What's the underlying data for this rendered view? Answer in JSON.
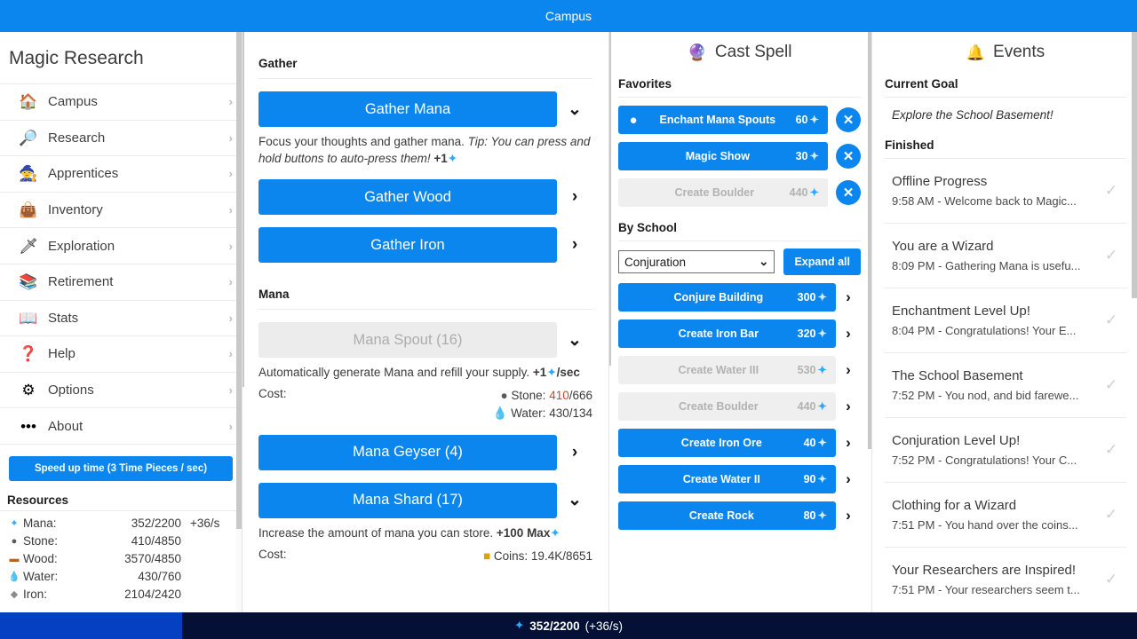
{
  "window": {
    "title": "Campus"
  },
  "sidebar": {
    "app_title": "Magic Research",
    "items": [
      {
        "label": "Campus",
        "icon": "house-icon",
        "glyph": "🏠",
        "chevron": "›"
      },
      {
        "label": "Research",
        "icon": "magnifier-icon",
        "glyph": "🔎",
        "chevron": "›"
      },
      {
        "label": "Apprentices",
        "icon": "wizard-hat-icon",
        "glyph": "🧙",
        "chevron": "›"
      },
      {
        "label": "Inventory",
        "icon": "sack-icon",
        "glyph": "👜",
        "chevron": "›"
      },
      {
        "label": "Exploration",
        "icon": "sword-icon",
        "glyph": "🗡",
        "chevron": "›"
      },
      {
        "label": "Retirement",
        "icon": "books-icon",
        "glyph": "📚",
        "chevron": "›"
      },
      {
        "label": "Stats",
        "icon": "open-book-icon",
        "glyph": "📖",
        "chevron": "›"
      },
      {
        "label": "Help",
        "icon": "question-key-icon",
        "glyph": "❓",
        "chevron": "›"
      },
      {
        "label": "Options",
        "icon": "gear-icon",
        "glyph": "⚙",
        "chevron": "›"
      },
      {
        "label": "About",
        "icon": "ellipsis-icon",
        "glyph": "•••",
        "chevron": "›"
      }
    ],
    "speed_up_label": "Speed up time (3 Time Pieces / sec)",
    "resources_title": "Resources",
    "resources": [
      {
        "icon": "mana-star-icon",
        "glyph": "⭐",
        "name": "Mana:",
        "value": "352/2200",
        "rate": "+36/s"
      },
      {
        "icon": "stone-icon",
        "glyph": "●",
        "name": "Stone:",
        "value": "410/4850",
        "rate": ""
      },
      {
        "icon": "wood-icon",
        "glyph": "▬",
        "name": "Wood:",
        "value": "3570/4850",
        "rate": ""
      },
      {
        "icon": "water-drop-icon",
        "glyph": "💧",
        "name": "Water:",
        "value": "430/760",
        "rate": ""
      },
      {
        "icon": "iron-icon",
        "glyph": "◆",
        "name": "Iron:",
        "value": "2104/2420",
        "rate": ""
      }
    ]
  },
  "gather": {
    "section_title": "Gather",
    "buttons": [
      {
        "label": "Gather Mana",
        "disabled": false,
        "chevron": "⌄",
        "expanded": true
      },
      {
        "label": "Gather Wood",
        "disabled": false,
        "chevron": "›",
        "expanded": false
      },
      {
        "label": "Gather Iron",
        "disabled": false,
        "chevron": "›",
        "expanded": false
      }
    ],
    "mana_desc_plain": "Focus your thoughts and gather mana. ",
    "mana_desc_italic": "Tip: You can press and hold buttons to auto-press them!",
    "mana_desc_gain": " +1",
    "mana_section_title": "Mana"
  },
  "mana": {
    "spout": {
      "label": "Mana Spout (16)",
      "disabled": true,
      "chevron": "⌄",
      "desc_plain": "Automatically generate Mana and refill your supply. ",
      "desc_gain": "+1",
      "desc_suffix": "/sec",
      "cost_label": "Cost:",
      "costs": [
        {
          "icon": "stone-icon",
          "glyph": "●",
          "name": "Stone:",
          "have": "410",
          "need": "/666",
          "insufficient": true
        },
        {
          "icon": "water-drop-icon",
          "glyph": "💧",
          "name": "Water:",
          "have": "430",
          "need": "/134",
          "insufficient": false
        }
      ]
    },
    "geyser": {
      "label": "Mana Geyser (4)",
      "disabled": false,
      "chevron": "›"
    },
    "shard": {
      "label": "Mana Shard (17)",
      "disabled": false,
      "chevron": "⌄",
      "desc_plain": "Increase the amount of mana you can store. ",
      "desc_gain": "+100 Max",
      "cost_label": "Cost:",
      "costs": [
        {
          "icon": "coins-icon",
          "glyph": "💰",
          "name": "Coins:",
          "have": "19.4K",
          "need": "/8651",
          "insufficient": false
        }
      ]
    }
  },
  "cast_spell": {
    "panel_title": "Cast Spell",
    "panel_icon": "magic-wand-icon",
    "favorites_title": "Favorites",
    "favorites": [
      {
        "name": "Enchant Mana Spouts",
        "cost": "60",
        "active": true,
        "disabled": false,
        "remove": "✕"
      },
      {
        "name": "Magic Show",
        "cost": "30",
        "active": false,
        "disabled": false,
        "remove": "✕"
      },
      {
        "name": "Create Boulder",
        "cost": "440",
        "active": false,
        "disabled": true,
        "remove": "✕"
      }
    ],
    "by_school_title": "By School",
    "school_selected": "Conjuration",
    "school_options": [
      "Conjuration"
    ],
    "expand_all_label": "Expand all",
    "spells": [
      {
        "name": "Conjure Building",
        "cost": "300",
        "disabled": false,
        "chevron": "›"
      },
      {
        "name": "Create Iron Bar",
        "cost": "320",
        "disabled": false,
        "chevron": "›"
      },
      {
        "name": "Create Water III",
        "cost": "530",
        "disabled": true,
        "chevron": "›"
      },
      {
        "name": "Create Boulder",
        "cost": "440",
        "disabled": true,
        "chevron": "›"
      },
      {
        "name": "Create Iron Ore",
        "cost": "40",
        "disabled": false,
        "chevron": "›"
      },
      {
        "name": "Create Water II",
        "cost": "90",
        "disabled": false,
        "chevron": "›"
      },
      {
        "name": "Create Rock",
        "cost": "80",
        "disabled": false,
        "chevron": "›"
      }
    ]
  },
  "events": {
    "panel_title": "Events",
    "panel_icon": "bell-icon",
    "current_goal_title": "Current Goal",
    "current_goal": "Explore the School Basement!",
    "finished_title": "Finished",
    "finished": [
      {
        "title": "Offline Progress",
        "sub": "9:58 AM - Welcome back to Magic...",
        "check": "✓"
      },
      {
        "title": "You are a Wizard",
        "sub": "8:09 PM - Gathering Mana is usefu...",
        "check": "✓"
      },
      {
        "title": "Enchantment Level Up!",
        "sub": "8:04 PM - Congratulations! Your E...",
        "check": "✓"
      },
      {
        "title": "The School Basement",
        "sub": "7:52 PM - You nod, and bid farewe...",
        "check": "✓"
      },
      {
        "title": "Conjuration Level Up!",
        "sub": "7:52 PM - Congratulations! Your C...",
        "check": "✓"
      },
      {
        "title": "Clothing for a Wizard",
        "sub": "7:51 PM - You hand over the coins...",
        "check": "✓"
      },
      {
        "title": "Your Researchers are Inspired!",
        "sub": "7:51 PM - Your researchers seem t...",
        "check": "✓"
      }
    ]
  },
  "status_bar": {
    "icon": "mana-star-icon",
    "value": "352/2200",
    "rate": "(+36/s)",
    "fill_percent": 16
  },
  "colors": {
    "accent": "#0c86ef",
    "titlebar": "#0c86ef",
    "status_bg": "#041036",
    "status_fill": "#0540c2",
    "disabled_bg": "#ececec",
    "insufficient": "#e13b2b"
  }
}
